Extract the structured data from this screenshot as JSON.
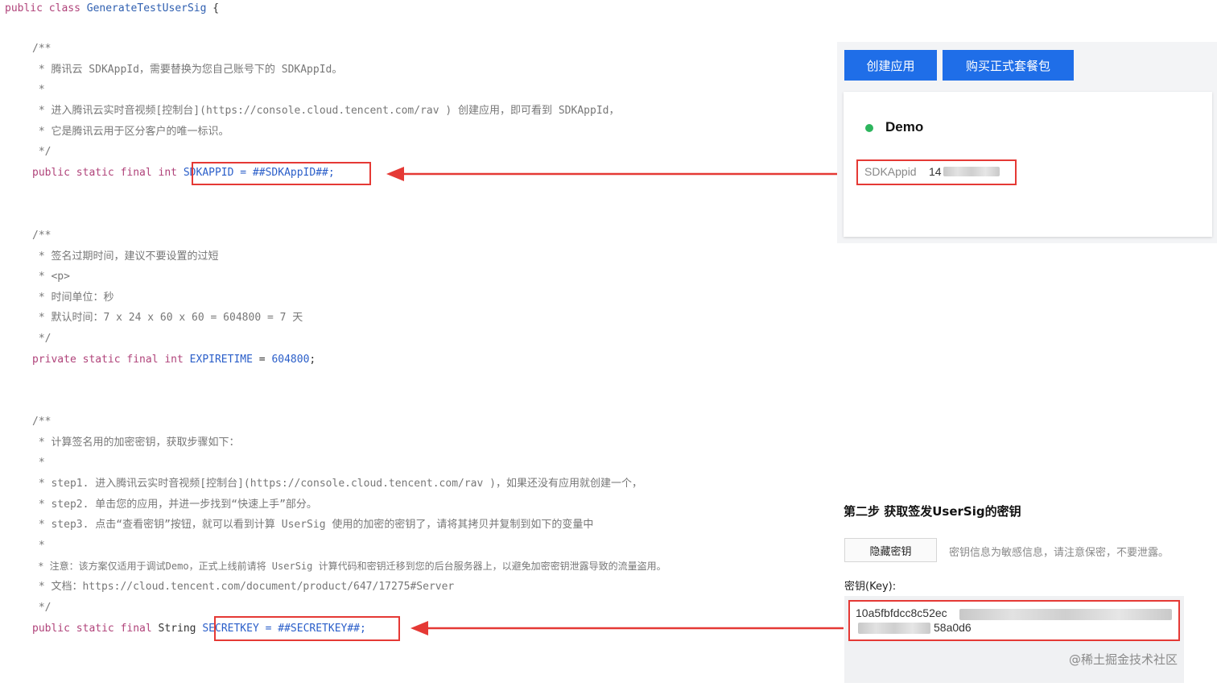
{
  "code": {
    "class_decl": {
      "kw": "public class",
      "name": "GenerateTestUserSig",
      "brace": "{"
    },
    "comment1": [
      "/**",
      " * 腾讯云 SDKAppId，需要替换为您自己账号下的 SDKAppId。",
      " *",
      " * 进入腾讯云实时音视频[控制台](https://console.cloud.tencent.com/rav ) 创建应用，即可看到 SDKAppId，",
      " * 它是腾讯云用于区分客户的唯一标识。",
      " */"
    ],
    "sdkappid_decl": {
      "kw": "public static final int",
      "expr": "SDKAPPID = ##SDKAppID##;"
    },
    "comment2": [
      "/**",
      " * 签名过期时间，建议不要设置的过短",
      " * <p>",
      " * 时间单位：秒",
      " * 默认时间：7 x 24 x 60 x 60 = 604800 = 7 天",
      " */"
    ],
    "expire_decl": {
      "kw": "private static final int",
      "name": "EXPIRETIME",
      "eq": " = ",
      "value": "604800",
      "end": ";"
    },
    "comment3": [
      "/**",
      " * 计算签名用的加密密钥，获取步骤如下：",
      " *",
      " * step1. 进入腾讯云实时音视频[控制台](https://console.cloud.tencent.com/rav )，如果还没有应用就创建一个，",
      " * step2. 单击您的应用，并进一步找到“快速上手”部分。",
      " * step3. 点击“查看密钥”按钮，就可以看到计算 UserSig 使用的加密的密钥了，请将其拷贝并复制到如下的变量中",
      " *",
      " * 注意：该方案仅适用于调试Demo，正式上线前请将 UserSig 计算代码和密钥迁移到您的后台服务器上，以避免加密密钥泄露导致的流量盗用。",
      " * 文档：https://cloud.tencent.com/document/product/647/17275#Server",
      " */"
    ],
    "secret_decl": {
      "kw": "public static final",
      "type": " String",
      "expr": "SECRETKEY = ##SECRETKEY##;"
    }
  },
  "console": {
    "create_app_button": "创建应用",
    "buy_package_button": "购买正式套餐包",
    "app_name": "Demo",
    "sdkappid_label": "SDKAppid",
    "sdkappid_value_visible": "14",
    "step2_title": "第二步 获取签发UserSig的密钥",
    "hide_key_button": "隐藏密钥",
    "key_hint": "密钥信息为敏感信息，请注意保密，不要泄露。",
    "key_label": "密钥(Key):",
    "key_line1": "10a5fbfdcc8c52ec",
    "key_line2": "58a0d6"
  },
  "watermark": "@稀土掘金技术社区",
  "colors": {
    "accent_blue": "#1f6ee8",
    "highlight_red": "#e53935",
    "status_green": "#2db55d"
  }
}
